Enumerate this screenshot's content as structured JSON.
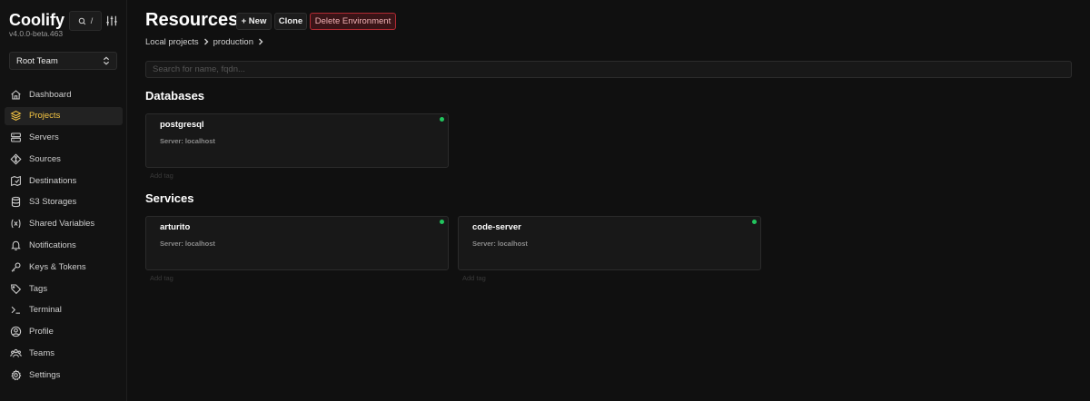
{
  "app": {
    "name": "Coolify",
    "version": "v4.0.0-beta.463",
    "search_shortcut": "/"
  },
  "team": {
    "selected": "Root Team"
  },
  "sidebar": {
    "items": [
      {
        "label": "Dashboard",
        "icon": "home-icon",
        "active": false
      },
      {
        "label": "Projects",
        "icon": "layers-icon",
        "active": true
      },
      {
        "label": "Servers",
        "icon": "server-icon",
        "active": false
      },
      {
        "label": "Sources",
        "icon": "git-icon",
        "active": false
      },
      {
        "label": "Destinations",
        "icon": "destination-icon",
        "active": false
      },
      {
        "label": "S3 Storages",
        "icon": "database-icon",
        "active": false
      },
      {
        "label": "Shared Variables",
        "icon": "variable-icon",
        "active": false
      },
      {
        "label": "Notifications",
        "icon": "bell-icon",
        "active": false
      },
      {
        "label": "Keys & Tokens",
        "icon": "key-icon",
        "active": false
      },
      {
        "label": "Tags",
        "icon": "tag-icon",
        "active": false
      },
      {
        "label": "Terminal",
        "icon": "terminal-icon",
        "active": false
      },
      {
        "label": "Profile",
        "icon": "user-icon",
        "active": false
      },
      {
        "label": "Teams",
        "icon": "users-icon",
        "active": false
      },
      {
        "label": "Settings",
        "icon": "gear-icon",
        "active": false
      }
    ]
  },
  "header": {
    "title": "Resources",
    "new_label": "+ New",
    "clone_label": "Clone",
    "delete_label": "Delete Environment"
  },
  "breadcrumb": {
    "project": "Local projects",
    "environment": "production"
  },
  "search": {
    "placeholder": "Search for name, fqdn..."
  },
  "sections": {
    "databases": {
      "title": "Databases",
      "cards": [
        {
          "name": "postgresql",
          "server": "Server: localhost",
          "tag_action": "Add tag",
          "status": "running"
        }
      ]
    },
    "services": {
      "title": "Services",
      "cards": [
        {
          "name": "arturito",
          "server": "Server: localhost",
          "tag_action": "Add tag",
          "status": "running"
        },
        {
          "name": "code-server",
          "server": "Server: localhost",
          "tag_action": "Add tag",
          "status": "running"
        }
      ]
    }
  },
  "colors": {
    "background": "#101010",
    "accent_active": "#f5c542",
    "danger": "#b22a33",
    "status_running": "#22c55e"
  }
}
